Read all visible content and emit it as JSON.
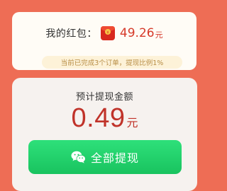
{
  "balance": {
    "label": "我的红包：",
    "amount": "49.26",
    "unit": "元",
    "icon": "red-envelope-icon"
  },
  "status": {
    "text": "当前已完成3个订单，提现比例1%"
  },
  "withdraw": {
    "title": "预计提现金额",
    "amount": "0.49",
    "unit": "元",
    "button_label": "全部提现",
    "button_icon": "wechat-icon"
  },
  "colors": {
    "background": "#ee6d55",
    "accent_red": "#c0332a",
    "button_green": "#1fca66",
    "pill_background": "#fdf2d8",
    "pill_text": "#b88d45"
  }
}
